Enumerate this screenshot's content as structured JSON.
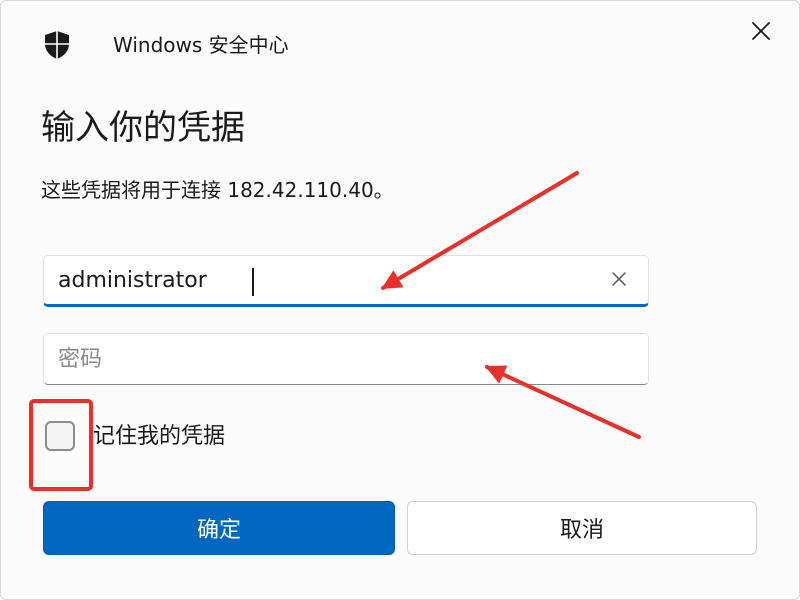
{
  "window": {
    "title": "Windows 安全中心",
    "app_icon": "shield-icon",
    "close_icon": "close-icon"
  },
  "dialog": {
    "heading": "输入你的凭据",
    "subtext": "这些凭据将用于连接 182.42.110.40。"
  },
  "username": {
    "value": "administrator",
    "clear_icon": "clear-icon"
  },
  "password": {
    "value": "",
    "placeholder": "密码"
  },
  "remember": {
    "label": "记住我的凭据",
    "checked": false
  },
  "buttons": {
    "ok_label": "确定",
    "cancel_label": "取消"
  },
  "colors": {
    "accent": "#0067c0",
    "annotation": "#e8302a"
  },
  "annotations": {
    "arrows": [
      "arrow-to-username",
      "arrow-to-password"
    ],
    "highlight": "checkbox-highlight-box"
  }
}
